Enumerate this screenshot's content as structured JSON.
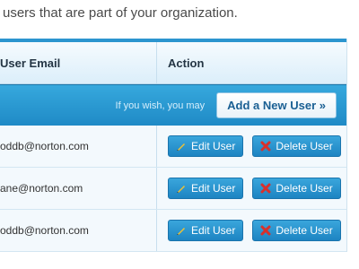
{
  "intro_text": "users that are part of your organization.",
  "table": {
    "col_email": "User Email",
    "col_action": "Action",
    "bar_note": "If you wish, you may",
    "add_button": "Add a New User »",
    "edit_label": "Edit User",
    "delete_label": "Delete User",
    "rows": [
      {
        "email": "oddb@norton.com"
      },
      {
        "email": "ane@norton.com"
      },
      {
        "email": "oddb@norton.com"
      }
    ]
  },
  "colors": {
    "accent": "#2c95cf",
    "button": "#1d84c2",
    "delete_icon": "#d9302b",
    "edit_icon": "#f2c230"
  },
  "icons": {
    "edit": "pencil-icon",
    "delete": "x-icon"
  }
}
